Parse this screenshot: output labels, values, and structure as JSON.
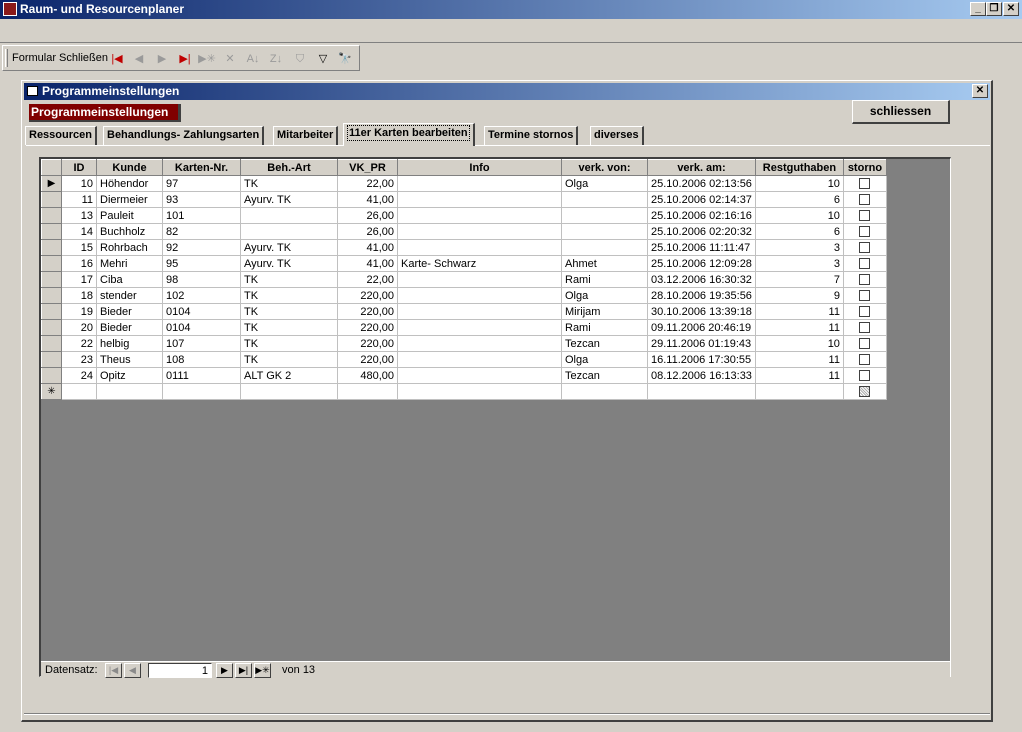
{
  "app": {
    "title": "Raum- und Resourcenplaner",
    "minimize": "_",
    "restore": "❐",
    "close": "✕"
  },
  "toolbar": {
    "label": "Formular Schließen",
    "icons": [
      "first-record-icon",
      "prev-record-icon",
      "next-record-icon",
      "last-record-icon",
      "new-record-icon",
      "delete-record-icon",
      "sort-asc-icon",
      "sort-desc-icon",
      "filter-by-selection-icon",
      "filter-icon",
      "find-icon"
    ]
  },
  "form": {
    "title": "Programmeinstellungen",
    "header_label": "Programmeinstellungen",
    "close_button": "schliessen",
    "close_glyph": "✕"
  },
  "tabs": [
    {
      "label": "Ressourcen",
      "active": false
    },
    {
      "label": "Behandlungs- Zahlungsarten",
      "active": false
    },
    {
      "label": "Mitarbeiter",
      "active": false
    },
    {
      "label": "11er Karten bearbeiten",
      "active": true
    },
    {
      "label": "Termine stornos",
      "active": false
    },
    {
      "label": "diverses",
      "active": false
    }
  ],
  "table": {
    "columns": [
      "ID",
      "Kunde",
      "Karten-Nr.",
      "Beh.-Art",
      "VK_PR",
      "Info",
      "verk. von:",
      "verk. am:",
      "Restguthaben",
      "storno"
    ],
    "rows": [
      [
        "10",
        "Höhendor",
        "97",
        "TK",
        "22,00",
        "",
        "Olga",
        "25.10.2006 02:13:56",
        "10"
      ],
      [
        "11",
        "Diermeier",
        "93",
        "Ayurv. TK",
        "41,00",
        "",
        "",
        "25.10.2006 02:14:37",
        "6"
      ],
      [
        "13",
        "Pauleit",
        "101",
        "",
        "26,00",
        "",
        "",
        "25.10.2006 02:16:16",
        "10"
      ],
      [
        "14",
        "Buchholz",
        "82",
        "",
        "26,00",
        "",
        "",
        "25.10.2006 02:20:32",
        "6"
      ],
      [
        "15",
        "Rohrbach",
        "92",
        "Ayurv. TK",
        "41,00",
        "",
        "",
        "25.10.2006 11:11:47",
        "3"
      ],
      [
        "16",
        "Mehri",
        "95",
        "Ayurv. TK",
        "41,00",
        "Karte- Schwarz",
        "Ahmet",
        "25.10.2006 12:09:28",
        "3"
      ],
      [
        "17",
        "Ciba",
        "98",
        "TK",
        "22,00",
        "",
        "Rami",
        "03.12.2006 16:30:32",
        "7"
      ],
      [
        "18",
        "stender",
        "102",
        "TK",
        "220,00",
        "",
        "Olga",
        "28.10.2006 19:35:56",
        "9"
      ],
      [
        "19",
        "Bieder",
        "0104",
        "TK",
        "220,00",
        "",
        "Mirijam",
        "30.10.2006 13:39:18",
        "11"
      ],
      [
        "20",
        "Bieder",
        "0104",
        "TK",
        "220,00",
        "",
        "Rami",
        "09.11.2006 20:46:19",
        "11"
      ],
      [
        "22",
        "helbig",
        "107",
        "TK",
        "220,00",
        "",
        "Tezcan",
        "29.11.2006 01:19:43",
        "10"
      ],
      [
        "23",
        "Theus",
        "108",
        "TK",
        "220,00",
        "",
        "Olga",
        "16.11.2006 17:30:55",
        "11"
      ],
      [
        "24",
        "Opitz",
        "0111",
        "ALT GK 2",
        "480,00",
        "",
        "Tezcan",
        "08.12.2006 16:13:33",
        "11"
      ]
    ],
    "current_row_marker": "▶",
    "new_row_marker": "✳"
  },
  "navigation": {
    "label": "Datensatz:",
    "current": "1",
    "of_label": "von",
    "total": "13"
  }
}
